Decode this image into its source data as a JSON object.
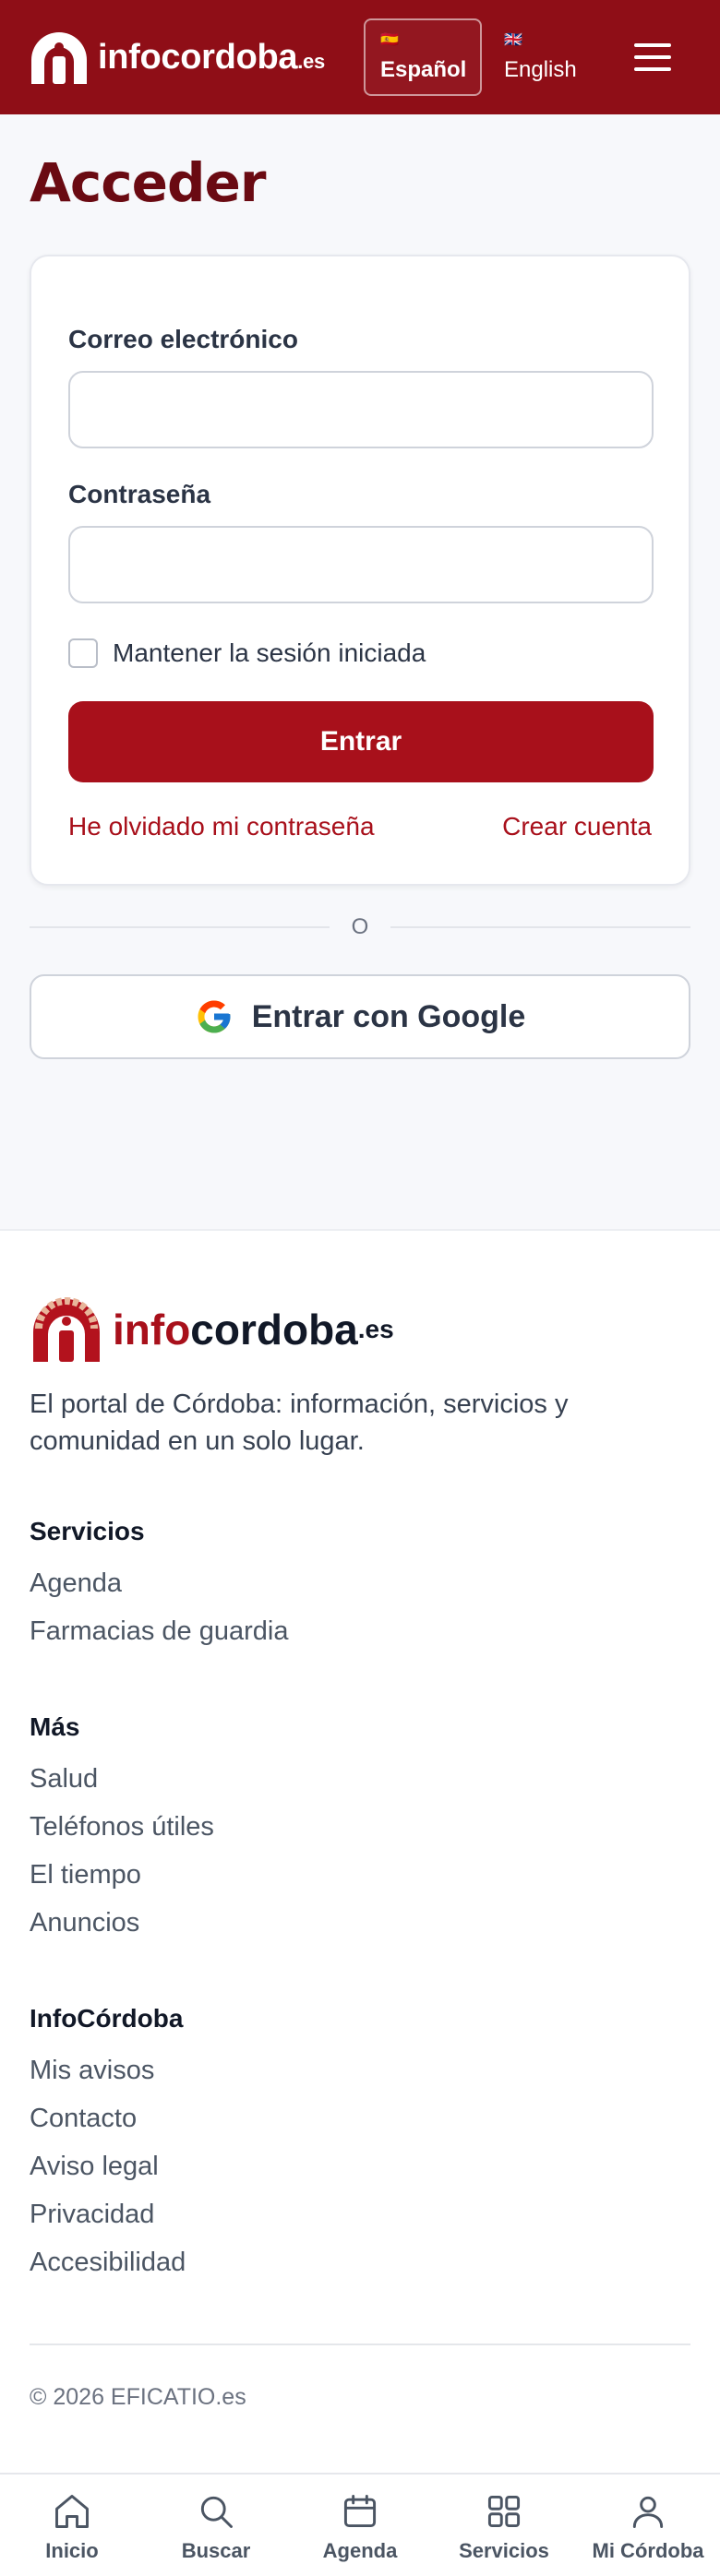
{
  "colors": {
    "brand": "#8f0e17",
    "accent": "#a8101b",
    "title": "#6a0a12"
  },
  "header": {
    "logo_text": "infocordoba",
    "logo_tld": ".es",
    "languages": [
      {
        "flag": "🇪🇸",
        "label": "Español",
        "active": true
      },
      {
        "flag": "🇬🇧",
        "label": "English",
        "active": false
      }
    ],
    "menu_icon": "hamburger-icon"
  },
  "login": {
    "title": "Acceder",
    "email_label": "Correo electrónico",
    "email_value": "",
    "password_label": "Contraseña",
    "password_value": "",
    "remember_label": "Mantener la sesión iniciada",
    "remember_checked": false,
    "submit_label": "Entrar",
    "forgot_link": "He olvidado mi contraseña",
    "create_link": "Crear cuenta",
    "divider_text": "O",
    "google_label": "Entrar con Google"
  },
  "footer": {
    "logo_part1": "info",
    "logo_part2": "cordoba",
    "logo_tld": ".es",
    "description": "El portal de Córdoba: información, servicios y comunidad en un solo lugar.",
    "sections": [
      {
        "heading": "Servicios",
        "links": [
          "Agenda",
          "Farmacias de guardia"
        ]
      },
      {
        "heading": "Más",
        "links": [
          "Salud",
          "Teléfonos útiles",
          "El tiempo",
          "Anuncios"
        ]
      },
      {
        "heading": "InfoCórdoba",
        "links": [
          "Mis avisos",
          "Contacto",
          "Aviso legal",
          "Privacidad",
          "Accesibilidad"
        ]
      }
    ],
    "copyright": "© 2026 EFICATIO.es"
  },
  "bottom_nav": [
    {
      "label": "Inicio",
      "icon": "home-icon"
    },
    {
      "label": "Buscar",
      "icon": "search-icon"
    },
    {
      "label": "Agenda",
      "icon": "calendar-icon"
    },
    {
      "label": "Servicios",
      "icon": "grid-icon"
    },
    {
      "label": "Mi Córdoba",
      "icon": "user-icon"
    }
  ]
}
